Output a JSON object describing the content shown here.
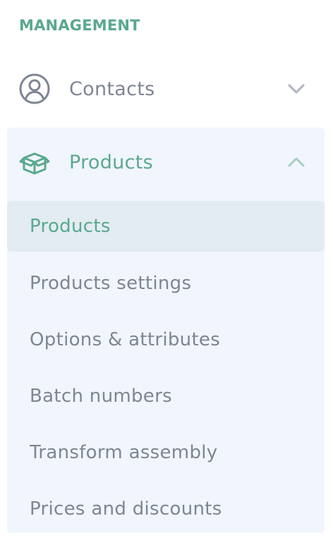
{
  "section": {
    "title": "MANAGEMENT"
  },
  "nav": {
    "contacts": {
      "label": "Contacts",
      "icon": "user-circle-icon",
      "chevron": "chevron-down-icon"
    },
    "products": {
      "label": "Products",
      "icon": "box-icon",
      "chevron": "chevron-up-icon",
      "items": [
        {
          "label": "Products",
          "active": true
        },
        {
          "label": "Products settings",
          "active": false
        },
        {
          "label": "Options & attributes",
          "active": false
        },
        {
          "label": "Batch numbers",
          "active": false
        },
        {
          "label": "Transform assembly",
          "active": false
        },
        {
          "label": "Prices and discounts",
          "active": false
        }
      ]
    }
  },
  "colors": {
    "accent": "#5aa88e",
    "muted_text": "#7e8594",
    "group_bg": "#f1f5fd",
    "active_bg": "#e2ecf2"
  }
}
